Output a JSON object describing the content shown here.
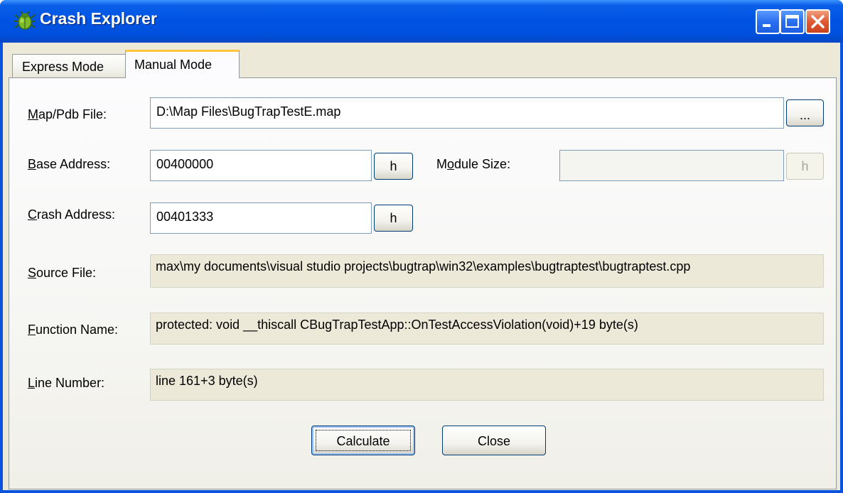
{
  "window": {
    "title": "Crash Explorer",
    "icon": "bug-icon"
  },
  "tabs": [
    {
      "label": "Express Mode",
      "selected": false
    },
    {
      "label": "Manual Mode",
      "selected": true
    }
  ],
  "form": {
    "map_file": {
      "label_accel": "M",
      "label_rest": "ap/Pdb File:",
      "value": "D:\\Map Files\\BugTrapTestE.map",
      "browse_label": "..."
    },
    "base_address": {
      "label_accel": "B",
      "label_rest": "ase Address:",
      "value": "00400000",
      "hex_label": "h"
    },
    "module_size": {
      "label_pre": "M",
      "label_accel": "o",
      "label_rest": "dule Size:",
      "value": "",
      "hex_label": "h"
    },
    "crash_address": {
      "label_accel": "C",
      "label_rest": "rash Address:",
      "value": "00401333",
      "hex_label": "h"
    },
    "source_file": {
      "label_accel": "S",
      "label_rest": "ource File:",
      "value": "max\\my documents\\visual studio projects\\bugtrap\\win32\\examples\\bugtraptest\\bugtraptest.cpp"
    },
    "function_name": {
      "label_accel": "F",
      "label_rest": "unction Name:",
      "value": "protected: void __thiscall CBugTrapTestApp::OnTestAccessViolation(void)+19 byte(s)"
    },
    "line_number": {
      "label_accel": "L",
      "label_rest": "ine Number:",
      "value": "line 161+3 byte(s)"
    }
  },
  "buttons": {
    "calculate": "Calculate",
    "close": "Close"
  }
}
